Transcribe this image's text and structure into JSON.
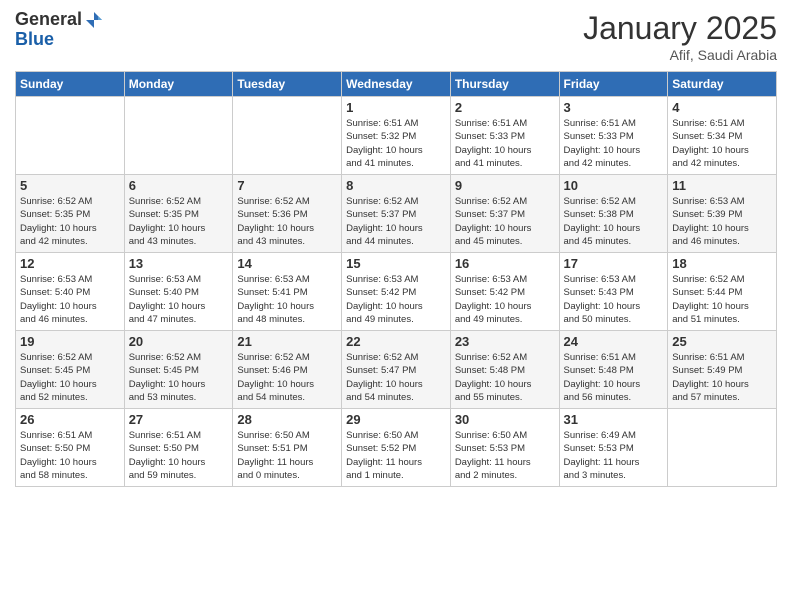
{
  "header": {
    "logo_general": "General",
    "logo_blue": "Blue",
    "month_title": "January 2025",
    "subtitle": "Afif, Saudi Arabia"
  },
  "days_of_week": [
    "Sunday",
    "Monday",
    "Tuesday",
    "Wednesday",
    "Thursday",
    "Friday",
    "Saturday"
  ],
  "weeks": [
    {
      "cells": [
        {
          "day": null,
          "info": null
        },
        {
          "day": null,
          "info": null
        },
        {
          "day": null,
          "info": null
        },
        {
          "day": "1",
          "info": "Sunrise: 6:51 AM\nSunset: 5:32 PM\nDaylight: 10 hours\nand 41 minutes."
        },
        {
          "day": "2",
          "info": "Sunrise: 6:51 AM\nSunset: 5:33 PM\nDaylight: 10 hours\nand 41 minutes."
        },
        {
          "day": "3",
          "info": "Sunrise: 6:51 AM\nSunset: 5:33 PM\nDaylight: 10 hours\nand 42 minutes."
        },
        {
          "day": "4",
          "info": "Sunrise: 6:51 AM\nSunset: 5:34 PM\nDaylight: 10 hours\nand 42 minutes."
        }
      ]
    },
    {
      "cells": [
        {
          "day": "5",
          "info": "Sunrise: 6:52 AM\nSunset: 5:35 PM\nDaylight: 10 hours\nand 42 minutes."
        },
        {
          "day": "6",
          "info": "Sunrise: 6:52 AM\nSunset: 5:35 PM\nDaylight: 10 hours\nand 43 minutes."
        },
        {
          "day": "7",
          "info": "Sunrise: 6:52 AM\nSunset: 5:36 PM\nDaylight: 10 hours\nand 43 minutes."
        },
        {
          "day": "8",
          "info": "Sunrise: 6:52 AM\nSunset: 5:37 PM\nDaylight: 10 hours\nand 44 minutes."
        },
        {
          "day": "9",
          "info": "Sunrise: 6:52 AM\nSunset: 5:37 PM\nDaylight: 10 hours\nand 45 minutes."
        },
        {
          "day": "10",
          "info": "Sunrise: 6:52 AM\nSunset: 5:38 PM\nDaylight: 10 hours\nand 45 minutes."
        },
        {
          "day": "11",
          "info": "Sunrise: 6:53 AM\nSunset: 5:39 PM\nDaylight: 10 hours\nand 46 minutes."
        }
      ]
    },
    {
      "cells": [
        {
          "day": "12",
          "info": "Sunrise: 6:53 AM\nSunset: 5:40 PM\nDaylight: 10 hours\nand 46 minutes."
        },
        {
          "day": "13",
          "info": "Sunrise: 6:53 AM\nSunset: 5:40 PM\nDaylight: 10 hours\nand 47 minutes."
        },
        {
          "day": "14",
          "info": "Sunrise: 6:53 AM\nSunset: 5:41 PM\nDaylight: 10 hours\nand 48 minutes."
        },
        {
          "day": "15",
          "info": "Sunrise: 6:53 AM\nSunset: 5:42 PM\nDaylight: 10 hours\nand 49 minutes."
        },
        {
          "day": "16",
          "info": "Sunrise: 6:53 AM\nSunset: 5:42 PM\nDaylight: 10 hours\nand 49 minutes."
        },
        {
          "day": "17",
          "info": "Sunrise: 6:53 AM\nSunset: 5:43 PM\nDaylight: 10 hours\nand 50 minutes."
        },
        {
          "day": "18",
          "info": "Sunrise: 6:52 AM\nSunset: 5:44 PM\nDaylight: 10 hours\nand 51 minutes."
        }
      ]
    },
    {
      "cells": [
        {
          "day": "19",
          "info": "Sunrise: 6:52 AM\nSunset: 5:45 PM\nDaylight: 10 hours\nand 52 minutes."
        },
        {
          "day": "20",
          "info": "Sunrise: 6:52 AM\nSunset: 5:45 PM\nDaylight: 10 hours\nand 53 minutes."
        },
        {
          "day": "21",
          "info": "Sunrise: 6:52 AM\nSunset: 5:46 PM\nDaylight: 10 hours\nand 54 minutes."
        },
        {
          "day": "22",
          "info": "Sunrise: 6:52 AM\nSunset: 5:47 PM\nDaylight: 10 hours\nand 54 minutes."
        },
        {
          "day": "23",
          "info": "Sunrise: 6:52 AM\nSunset: 5:48 PM\nDaylight: 10 hours\nand 55 minutes."
        },
        {
          "day": "24",
          "info": "Sunrise: 6:51 AM\nSunset: 5:48 PM\nDaylight: 10 hours\nand 56 minutes."
        },
        {
          "day": "25",
          "info": "Sunrise: 6:51 AM\nSunset: 5:49 PM\nDaylight: 10 hours\nand 57 minutes."
        }
      ]
    },
    {
      "cells": [
        {
          "day": "26",
          "info": "Sunrise: 6:51 AM\nSunset: 5:50 PM\nDaylight: 10 hours\nand 58 minutes."
        },
        {
          "day": "27",
          "info": "Sunrise: 6:51 AM\nSunset: 5:50 PM\nDaylight: 10 hours\nand 59 minutes."
        },
        {
          "day": "28",
          "info": "Sunrise: 6:50 AM\nSunset: 5:51 PM\nDaylight: 11 hours\nand 0 minutes."
        },
        {
          "day": "29",
          "info": "Sunrise: 6:50 AM\nSunset: 5:52 PM\nDaylight: 11 hours\nand 1 minute."
        },
        {
          "day": "30",
          "info": "Sunrise: 6:50 AM\nSunset: 5:53 PM\nDaylight: 11 hours\nand 2 minutes."
        },
        {
          "day": "31",
          "info": "Sunrise: 6:49 AM\nSunset: 5:53 PM\nDaylight: 11 hours\nand 3 minutes."
        },
        {
          "day": null,
          "info": null
        }
      ]
    }
  ]
}
